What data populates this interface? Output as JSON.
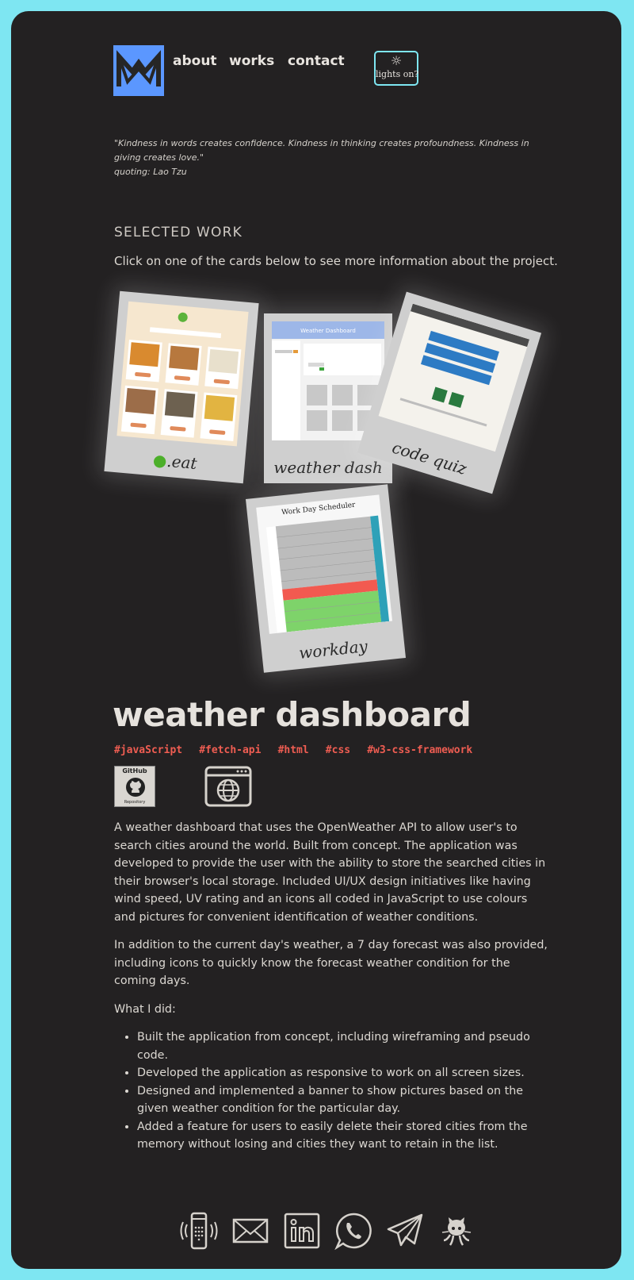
{
  "nav": {
    "links": [
      "about",
      "works",
      "contact"
    ],
    "lights_label": "lights on?"
  },
  "quote": {
    "text": "\"Kindness in words creates confidence. Kindness in thinking creates profoundness. Kindness in giving creates love.\"",
    "attribution": "quoting: Lao Tzu"
  },
  "works": {
    "heading": "SELECTED WORK",
    "intro": "Click on one of the cards below to see more information about the project.",
    "cards": [
      {
        "caption": ".eat"
      },
      {
        "caption": "weather dash",
        "screenshot_title": "Weather Dashboard"
      },
      {
        "caption": "code quiz"
      },
      {
        "caption": "workday",
        "screenshot_title": "Work Day Scheduler"
      }
    ]
  },
  "project": {
    "title": "weather dashboard",
    "tags": [
      "#javaScript",
      "#fetch-api",
      "#html",
      "#css",
      "#w3-css-framework"
    ],
    "github_button": {
      "top": "GitHub",
      "bottom": "Repository"
    },
    "paragraphs": [
      "A weather dashboard that uses the OpenWeather API to allow user's to search cities around the world. Built from concept. The application was developed to provide the user with the ability to store the searched cities in their browser's local storage. Included UI/UX design initiatives like having wind speed, UV rating and an icons all coded in JavaScript to use colours and pictures for convenient identification of weather conditions.",
      "In addition to the current day's weather, a 7 day forecast was also provided, including icons to quickly know the forecast weather condition for the coming days.",
      "What I did:"
    ],
    "bullets": [
      "Built the application from concept, including wireframing and pseudo code.",
      "Developed the application as responsive to work on all screen sizes.",
      "Designed and implemented a banner to show pictures based on the given weather condition for the particular day.",
      "Added a feature for users to easily delete their stored cities from the memory without losing and cities they want to retain in the list."
    ]
  },
  "footer": {
    "icons": [
      "phone-icon",
      "email-icon",
      "linkedin-icon",
      "whatsapp-icon",
      "telegram-icon",
      "github-icon"
    ]
  },
  "colors": {
    "frame": "#7ee6f2",
    "background": "#232122",
    "logo": "#5b97ff",
    "tag": "#ef5d52",
    "text": "#dcd8d2"
  }
}
